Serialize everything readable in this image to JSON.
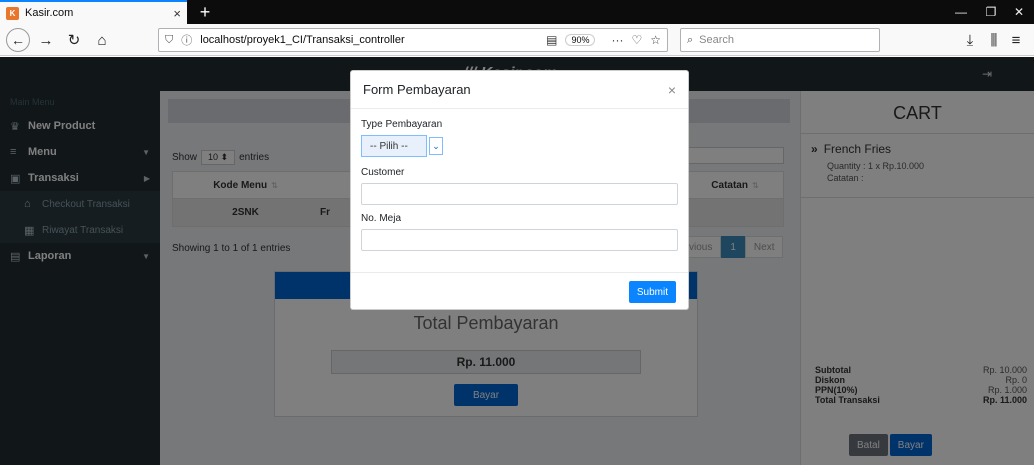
{
  "browser": {
    "tab_title": "Kasir.com",
    "tab_close": "×",
    "new_tab": "+",
    "url": "localhost/proyek1_CI/Transaksi_controller",
    "zoom": "90%",
    "search_placeholder": "Search",
    "win_minimize": "—",
    "win_restore": "❐",
    "win_close": "✕"
  },
  "app": {
    "brand": "/// Kasir.com"
  },
  "sidebar": {
    "header": "Main Menu",
    "items": [
      {
        "label": "New Product",
        "icon": "crown-icon"
      },
      {
        "label": "Menu",
        "icon": "list-icon"
      },
      {
        "label": "Transaksi",
        "icon": "calculator-icon"
      },
      {
        "label": "Checkout Transaksi",
        "icon": "bank-icon"
      },
      {
        "label": "Riwayat Transaksi",
        "icon": "calendar-icon"
      },
      {
        "label": "Laporan",
        "icon": "book-icon"
      }
    ]
  },
  "table": {
    "show": "Show",
    "entries_value": "10",
    "entries": "entries",
    "col_kode": "Kode Menu",
    "col_catatan": "Catatan",
    "row_kode": "2SNK",
    "row_fragment": "Fr",
    "showing": "Showing 1 to 1 of 1 entries",
    "prev": "vious",
    "page": "1",
    "next": "Next"
  },
  "payment": {
    "title": "Total Pembayaran",
    "amount": "Rp. 11.000",
    "button": "Bayar"
  },
  "cart": {
    "title": "CART",
    "item_name": "French Fries",
    "item_quantity": "Quantity : 1 x Rp.10.000",
    "item_note": "Catatan :",
    "subtotal_label": "Subtotal",
    "subtotal": "Rp. 10.000",
    "diskon_label": "Diskon",
    "diskon": "Rp. 0",
    "ppn_label": "PPN(10%)",
    "ppn": "Rp. 1.000",
    "total_label": "Total Transaksi",
    "total": "Rp. 11.000",
    "batal": "Batal",
    "bayar": "Bayar"
  },
  "modal": {
    "title": "Form Pembayaran",
    "close": "×",
    "type_label": "Type Pembayaran",
    "type_selected": "-- Pilih --",
    "customer_label": "Customer",
    "customer_value": "",
    "meja_label": "No. Meja",
    "meja_value": "",
    "submit": "Submit"
  },
  "colors": {
    "sidebar_bg": "#222d32",
    "primary": "#0366d6",
    "accent": "#0a84ff"
  }
}
